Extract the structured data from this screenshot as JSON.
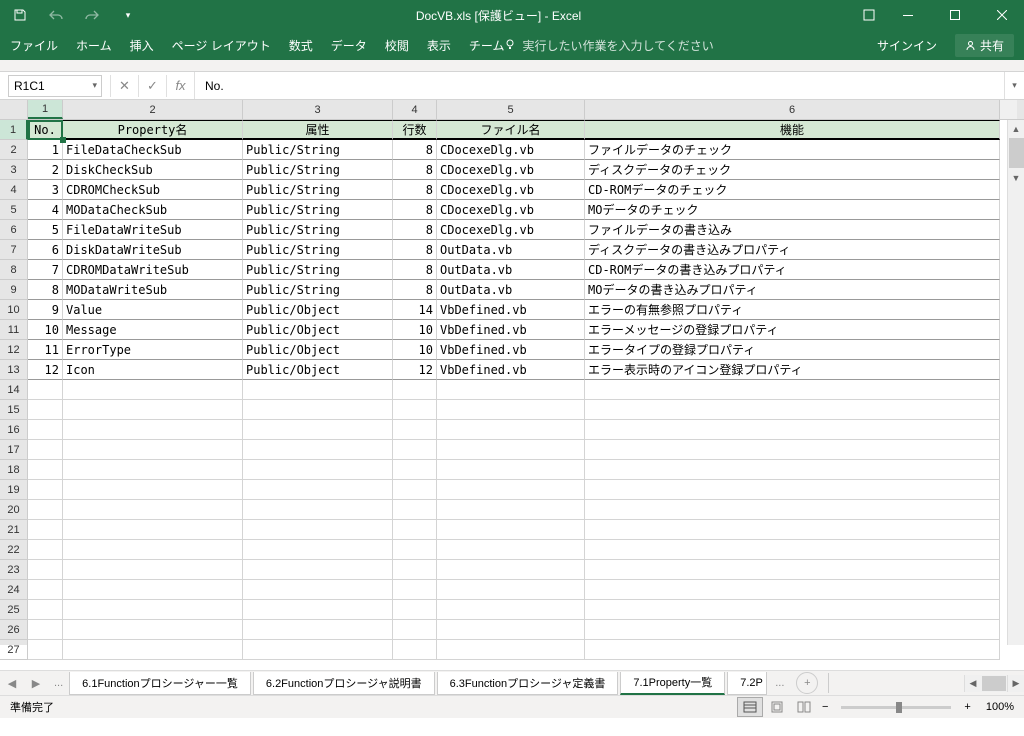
{
  "titlebar": {
    "title": "DocVB.xls  [保護ビュー] - Excel"
  },
  "ribbon": {
    "tabs": [
      "ファイル",
      "ホーム",
      "挿入",
      "ページ レイアウト",
      "数式",
      "データ",
      "校閲",
      "表示",
      "チーム"
    ],
    "search": "実行したい作業を入力してください",
    "signin": "サインイン",
    "share": "共有"
  },
  "formula_bar": {
    "name_box": "R1C1",
    "fx": "fx",
    "value": "No."
  },
  "columns": [
    "1",
    "2",
    "3",
    "4",
    "5",
    "6"
  ],
  "headers": [
    "No.",
    "Property名",
    "属性",
    "行数",
    "ファイル名",
    "機能"
  ],
  "rows": [
    {
      "no": "1",
      "prop": "FileDataCheckSub",
      "attr": "Public/String",
      "lines": "8",
      "file": "CDocexeDlg.vb",
      "func": "ファイルデータのチェック"
    },
    {
      "no": "2",
      "prop": "DiskCheckSub",
      "attr": "Public/String",
      "lines": "8",
      "file": "CDocexeDlg.vb",
      "func": "ディスクデータのチェック"
    },
    {
      "no": "3",
      "prop": "CDROMCheckSub",
      "attr": "Public/String",
      "lines": "8",
      "file": "CDocexeDlg.vb",
      "func": "CD-ROMデータのチェック"
    },
    {
      "no": "4",
      "prop": "MODataCheckSub",
      "attr": "Public/String",
      "lines": "8",
      "file": "CDocexeDlg.vb",
      "func": "MOデータのチェック"
    },
    {
      "no": "5",
      "prop": "FileDataWriteSub",
      "attr": "Public/String",
      "lines": "8",
      "file": "CDocexeDlg.vb",
      "func": "ファイルデータの書き込み"
    },
    {
      "no": "6",
      "prop": "DiskDataWriteSub",
      "attr": "Public/String",
      "lines": "8",
      "file": "OutData.vb",
      "func": "ディスクデータの書き込みプロパティ"
    },
    {
      "no": "7",
      "prop": "CDROMDataWriteSub",
      "attr": "Public/String",
      "lines": "8",
      "file": "OutData.vb",
      "func": "CD-ROMデータの書き込みプロパティ"
    },
    {
      "no": "8",
      "prop": "MODataWriteSub",
      "attr": "Public/String",
      "lines": "8",
      "file": "OutData.vb",
      "func": "MOデータの書き込みプロパティ"
    },
    {
      "no": "9",
      "prop": "Value",
      "attr": "Public/Object",
      "lines": "14",
      "file": "VbDefined.vb",
      "func": "エラーの有無参照プロパティ"
    },
    {
      "no": "10",
      "prop": "Message",
      "attr": "Public/Object",
      "lines": "10",
      "file": "VbDefined.vb",
      "func": "エラーメッセージの登録プロパティ"
    },
    {
      "no": "11",
      "prop": "ErrorType",
      "attr": "Public/Object",
      "lines": "10",
      "file": "VbDefined.vb",
      "func": "エラータイプの登録プロパティ"
    },
    {
      "no": "12",
      "prop": "Icon",
      "attr": "Public/Object",
      "lines": "12",
      "file": "VbDefined.vb",
      "func": "エラー表示時のアイコン登録プロパティ"
    }
  ],
  "row_labels": [
    "1",
    "2",
    "3",
    "4",
    "5",
    "6",
    "7",
    "8",
    "9",
    "10",
    "11",
    "12",
    "13",
    "14",
    "15",
    "16",
    "17",
    "18",
    "19",
    "20",
    "21",
    "22",
    "23",
    "24",
    "25",
    "26",
    "27"
  ],
  "sheet_tabs": {
    "tabs": [
      "6.1Functionプロシージャー一覧",
      "6.2Functionプロシージャ説明書",
      "6.3Functionプロシージャ定義書",
      "7.1Property一覧",
      "7.2P"
    ],
    "active_index": 3,
    "more": "..."
  },
  "status": {
    "text": "準備完了",
    "zoom": "100%"
  }
}
